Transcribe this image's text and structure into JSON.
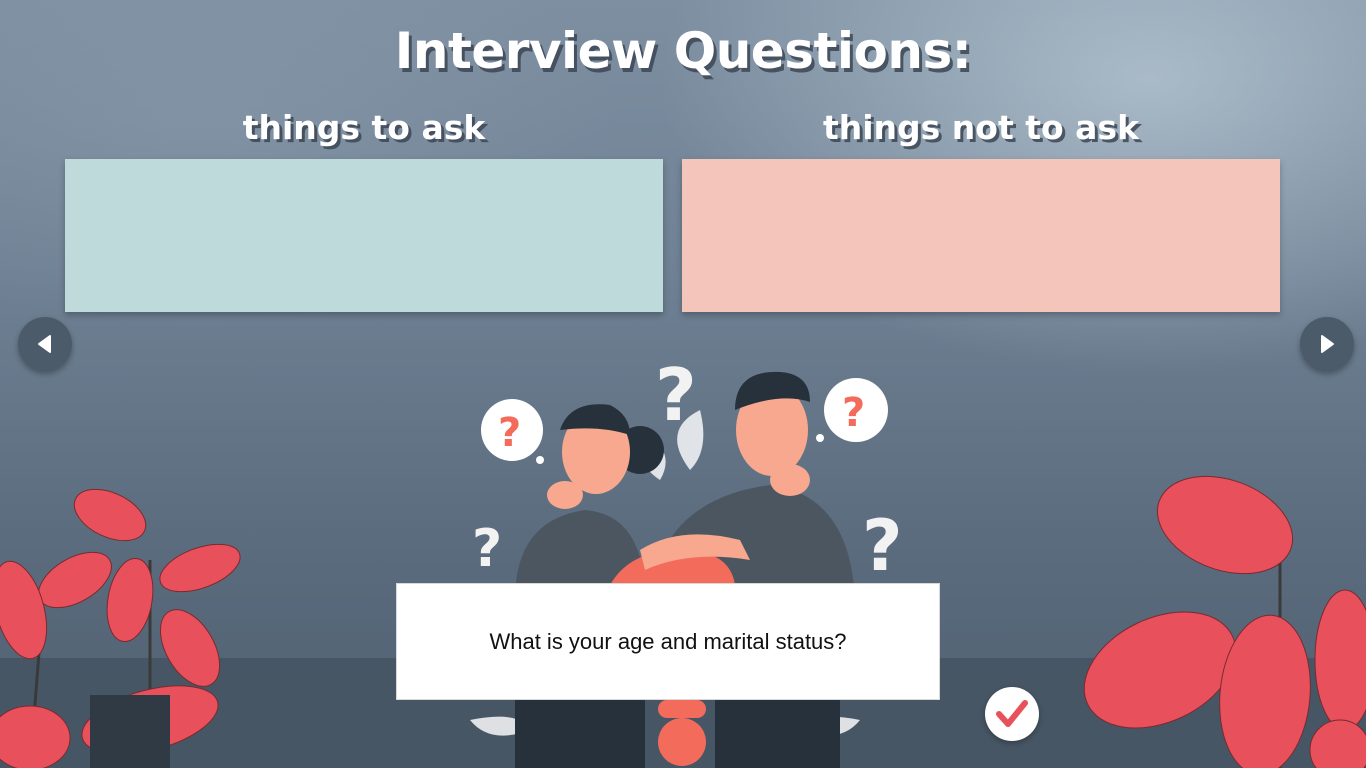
{
  "header": {
    "title": "Interview Questions:"
  },
  "columns": {
    "ask_label": "things to ask",
    "not_ask_label": "things not to ask"
  },
  "card": {
    "question": "What is your age and marital status?"
  },
  "navigation": {
    "prev_icon": "triangle-left-icon",
    "next_icon": "triangle-right-icon"
  },
  "submit": {
    "icon": "checkmark-icon"
  },
  "colors": {
    "ask_zone": "#bfdadb",
    "not_ask_zone": "#f4c5bb",
    "accent": "#e8505b",
    "nav_button": "#4b5b6a"
  }
}
